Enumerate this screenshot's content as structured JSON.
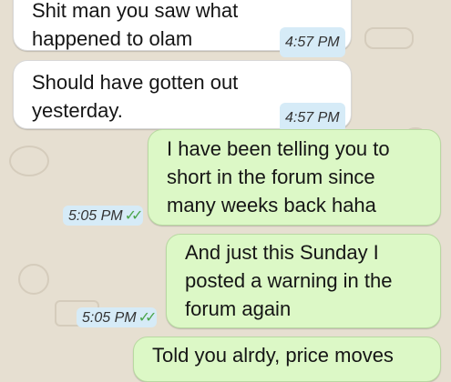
{
  "messages": [
    {
      "direction": "incoming",
      "text": "Shit man you saw what\nhappened to olam",
      "time": "4:57 PM"
    },
    {
      "direction": "incoming",
      "text": "Should have gotten out\nyesterday.",
      "time": "4:57 PM"
    },
    {
      "direction": "outgoing",
      "text": "I have been telling you to\nshort in the forum since\nmany weeks back haha",
      "time": "5:05 PM",
      "status": "read"
    },
    {
      "direction": "outgoing",
      "text": "And just this Sunday I\nposted a warning in the\nforum again",
      "time": "5:05 PM",
      "status": "read"
    },
    {
      "direction": "outgoing",
      "text": "Told you alrdy, price moves",
      "time": "",
      "status": ""
    }
  ],
  "icons": {
    "read_receipt": "double-check-icon"
  },
  "colors": {
    "incoming_bubble": "#ffffff",
    "outgoing_bubble": "#dcf8c6",
    "timestamp_bg": "#d6ebf7",
    "ticks": "#4aa44a",
    "wallpaper": "#e6dfd1"
  }
}
